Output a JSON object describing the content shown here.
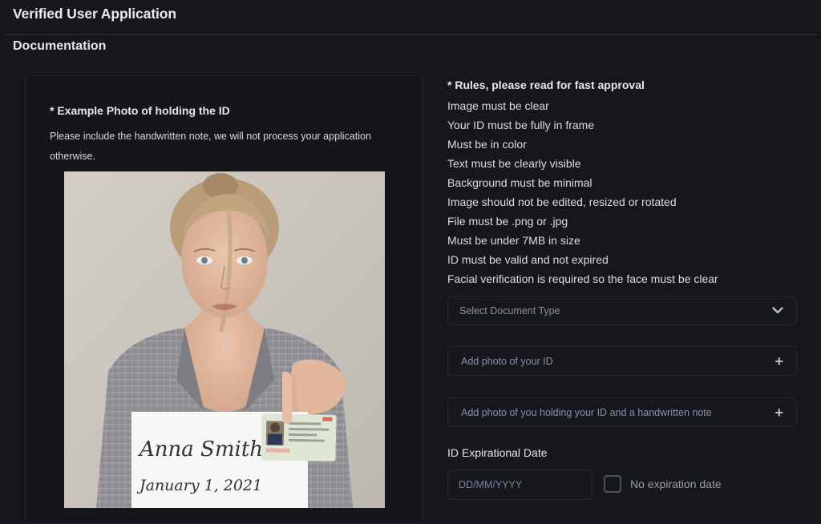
{
  "header": {
    "title": "Verified User Application"
  },
  "section": {
    "title": "Documentation"
  },
  "example": {
    "heading": "* Example Photo of holding the ID",
    "description": "Please include the handwritten note, we will not process your application otherwise.",
    "photo": {
      "alt": "Woman holding an ID card and a handwritten note",
      "note_line_1": "Anna Smith",
      "note_line_2": "January 1, 2021"
    }
  },
  "rules": {
    "heading": "* Rules, please read for fast approval",
    "items": [
      "Image must be clear",
      "Your ID must be fully in frame",
      "Must be in color",
      "Text must be clearly visible",
      "Background must be minimal",
      "Image should not be edited, resized or rotated",
      "File must be .png or .jpg",
      "Must be under 7MB in size",
      "ID must be valid and not expired",
      "Facial verification is required so the face must be clear"
    ]
  },
  "form": {
    "document_type": {
      "placeholder": "Select Document Type",
      "icon": "chevron-down-icon"
    },
    "id_photo": {
      "label": "Add photo of your ID",
      "icon": "plus-icon",
      "icon_glyph": "+"
    },
    "holding_photo": {
      "label": "Add photo of you holding your ID and a handwritten note",
      "icon": "plus-icon",
      "icon_glyph": "+"
    },
    "expiration": {
      "label": "ID Expirational Date",
      "placeholder": "DD/MM/YYYY",
      "value": "",
      "no_expiration_label": "No expiration date",
      "no_expiration_checked": false
    }
  },
  "colors": {
    "background": "#16171b",
    "border": "#25272d",
    "text_primary": "#e6e7ec",
    "placeholder": "#8a8ea6"
  }
}
